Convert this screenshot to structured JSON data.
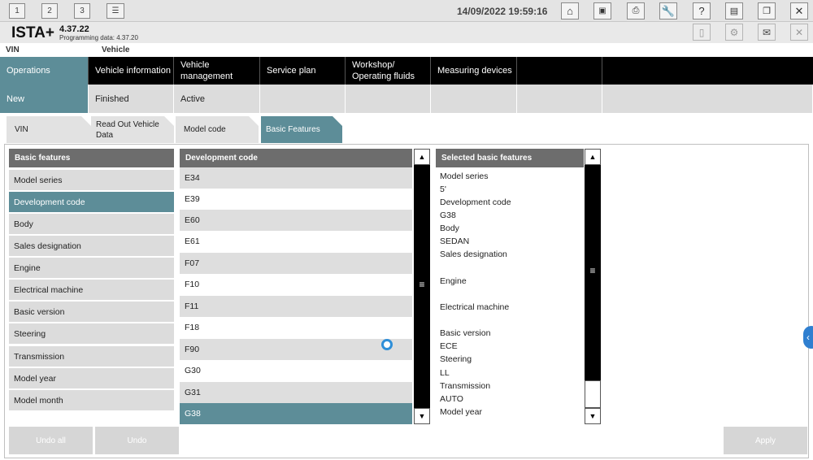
{
  "toolbar": {
    "session_tabs": [
      "1",
      "2",
      "3"
    ],
    "datetime": "14/09/2022 19:59:16",
    "icons": [
      "list-icon",
      "home-icon",
      "parts-icon",
      "print-icon",
      "wrench-icon",
      "help-icon",
      "collapse-icon",
      "window-icon",
      "close-icon"
    ]
  },
  "brand": {
    "name": "ISTA+",
    "version": "4.37.22",
    "programming_data": "Programming data:  4.37.20"
  },
  "vin_row": {
    "vin_label": "VIN",
    "vehicle_label": "Vehicle"
  },
  "main_nav": [
    {
      "label": "Operations",
      "active": true
    },
    {
      "label": "Vehicle information"
    },
    {
      "label": "Vehicle management"
    },
    {
      "label": "Service plan"
    },
    {
      "label": "Workshop/ Operating fluids"
    },
    {
      "label": "Measuring devices"
    }
  ],
  "sub_nav": [
    {
      "label": "New",
      "active": true
    },
    {
      "label": "Finished"
    },
    {
      "label": "Active"
    }
  ],
  "step_tabs": [
    {
      "label": "VIN"
    },
    {
      "label": "Read Out Vehicle Data"
    },
    {
      "label": "Model code"
    },
    {
      "label": "Basic Features",
      "active": true
    }
  ],
  "basic_features": {
    "header": "Basic features",
    "items": [
      "Model series",
      "Development code",
      "Body",
      "Sales designation",
      "Engine",
      "Electrical machine",
      "Basic version",
      "Steering",
      "Transmission",
      "Model year",
      "Model month"
    ],
    "selected": "Development code"
  },
  "development_code": {
    "header": "Development code",
    "items": [
      "E34",
      "E39",
      "E60",
      "E61",
      "F07",
      "F10",
      "F11",
      "F18",
      "F90",
      "G30",
      "G31",
      "G38"
    ],
    "selected": "G38"
  },
  "selected_features": {
    "header": "Selected basic features",
    "lines": [
      "Model series",
      "5'",
      "Development code",
      "G38",
      "Body",
      "SEDAN",
      "Sales designation",
      "",
      "Engine",
      "",
      "Electrical machine",
      "",
      "Basic version",
      "ECE",
      "Steering",
      "LL",
      "Transmission",
      "AUTO",
      "Model year"
    ]
  },
  "buttons": {
    "undo_all": "Undo all",
    "undo": "Undo",
    "apply": "Apply"
  },
  "colors": {
    "accent": "#5d8d98",
    "nav_bg": "#000000",
    "header_gray": "#6d6d6d"
  }
}
